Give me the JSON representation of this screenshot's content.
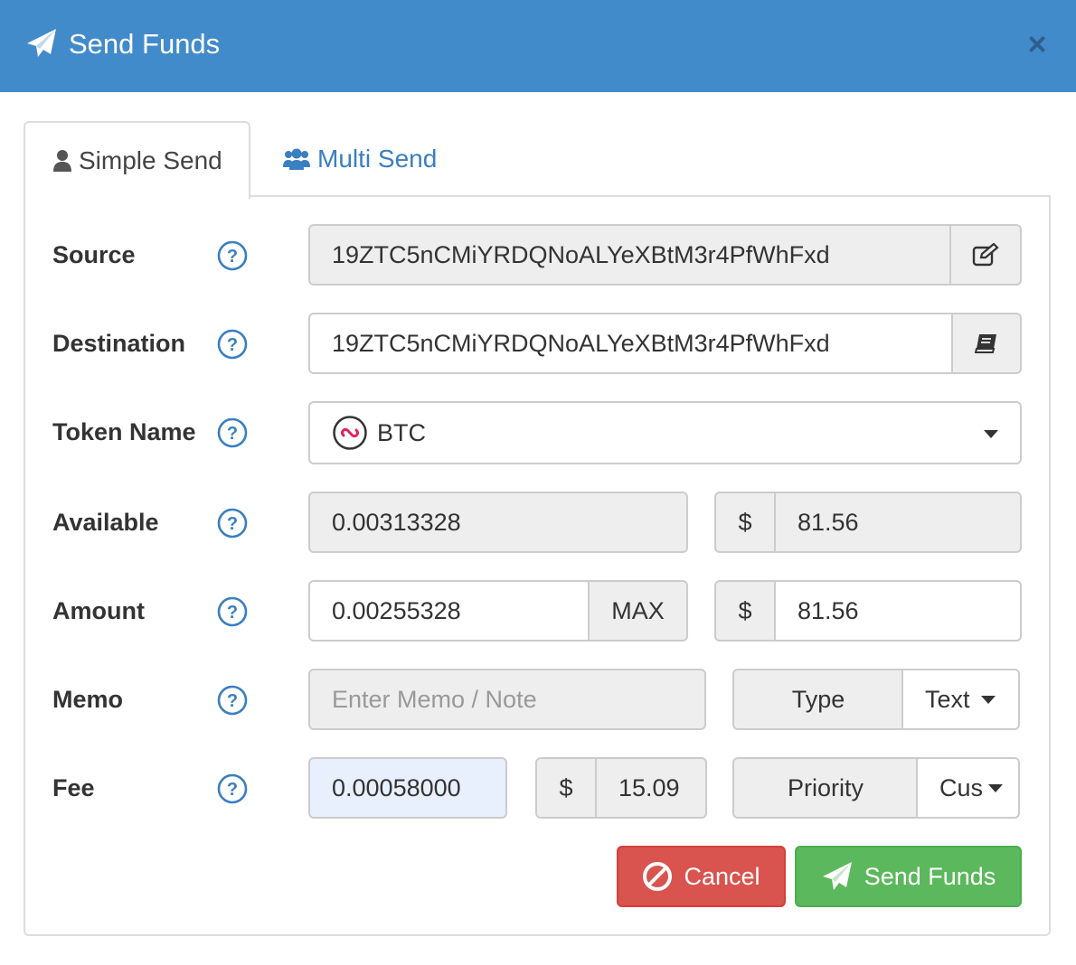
{
  "header": {
    "title": "Send Funds",
    "close_glyph": "×"
  },
  "tabs": [
    {
      "label": "Simple Send",
      "icon": "user-icon",
      "active": true
    },
    {
      "label": "Multi Send",
      "icon": "users-icon",
      "active": false
    }
  ],
  "form": {
    "source": {
      "label": "Source",
      "value": "19ZTC5nCMiYRDQNoALYeXBtM3r4PfWhFxd",
      "action_icon": "edit-icon"
    },
    "destination": {
      "label": "Destination",
      "value": "19ZTC5nCMiYRDQNoALYeXBtM3r4PfWhFxd",
      "action_icon": "address-book-icon"
    },
    "token": {
      "label": "Token Name",
      "value": "BTC",
      "icon": "token-logo-icon"
    },
    "available": {
      "label": "Available",
      "value": "0.00313328",
      "currency_symbol": "$",
      "usd_value": "81.56"
    },
    "amount": {
      "label": "Amount",
      "value": "0.00255328",
      "max_label": "MAX",
      "currency_symbol": "$",
      "usd_value": "81.56"
    },
    "memo": {
      "label": "Memo",
      "placeholder": "Enter Memo / Note",
      "type_label": "Type",
      "type_value": "Text"
    },
    "fee": {
      "label": "Fee",
      "value": "0.00058000",
      "currency_symbol": "$",
      "usd_value": "15.09",
      "priority_label": "Priority",
      "priority_value": "Cus"
    }
  },
  "buttons": {
    "cancel": "Cancel",
    "send": "Send Funds"
  },
  "colors": {
    "header": "#428bca",
    "cancel": "#d9534f",
    "send": "#5cb85c",
    "link": "#3a7fc0",
    "help": "#3a7fc0"
  }
}
